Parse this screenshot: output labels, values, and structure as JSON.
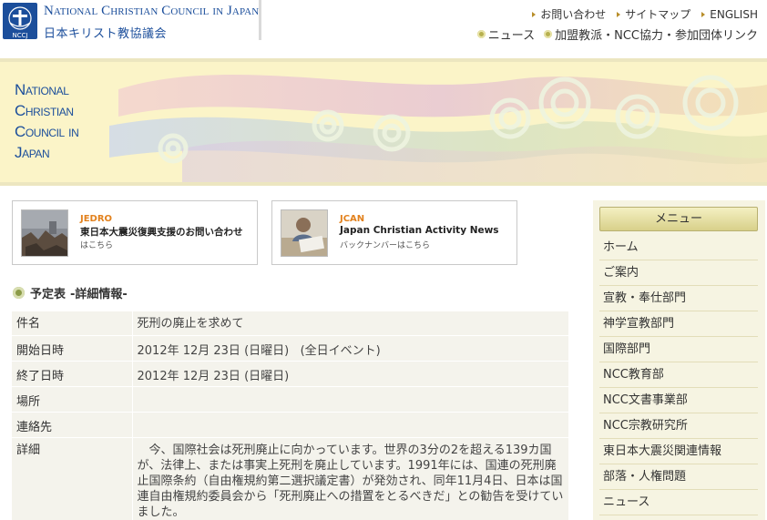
{
  "header": {
    "logo_text_en": "National Christian Council in Japan",
    "logo_text_ja": "日本キリスト教協議会",
    "logo_badge": "NCCJ",
    "utility_links": [
      "お問い合わせ",
      "サイトマップ",
      "ENGLISH"
    ],
    "main_links": [
      "ニュース",
      "加盟教派・NCC協力・参加団体リンク"
    ]
  },
  "banner": {
    "title_lines": [
      "National",
      "Christian",
      "Council in",
      "Japan"
    ]
  },
  "features": [
    {
      "tag": "JEDRO",
      "title": "東日本大震災復興支援のお問い合わせ",
      "subtitle": "はこちら"
    },
    {
      "tag": "JCAN",
      "title": "Japan Christian Activity News",
      "subtitle": "バックナンバーはこちら"
    }
  ],
  "section": {
    "title": "予定表",
    "subtitle": "-詳細情報-"
  },
  "details": [
    {
      "label": "件名",
      "value": "死刑の廃止を求めて"
    },
    {
      "label": "開始日時",
      "value": "2012年 12月 23日 (日曜日)   (全日イベント)"
    },
    {
      "label": "終了日時",
      "value": "2012年 12月 23日 (日曜日)"
    },
    {
      "label": "場所",
      "value": ""
    },
    {
      "label": "連絡先",
      "value": ""
    },
    {
      "label": "詳細",
      "value": "　今、国際社会は死刑廃止に向かっています。世界の3分の2を超える139カ国が、法律上、または事実上死刑を廃止しています。1991年には、国連の死刑廃止国際条約（自由権規約第二選択議定書）が発効され、同年11月4日、日本は国連自由権規約委員会から「死刑廃止への措置をとるべきだ」との勧告を受けていました。"
    }
  ],
  "sidebar": {
    "menu_title": "メニュー",
    "items": [
      "ホーム",
      "ご案内",
      "宣教・奉仕部門",
      "神学宣教部門",
      "国際部門",
      "NCC教育部",
      "NCC文書事業部",
      "NCC宗教研究所",
      "東日本大震災関連情報",
      "部落・人権問題",
      "ニュース"
    ]
  },
  "colors": {
    "brand_blue": "#1b4e9b",
    "accent_orange": "#e2811d",
    "table_bg": "#f4f3ec",
    "sidebar_bg": "#f6f4e2"
  }
}
